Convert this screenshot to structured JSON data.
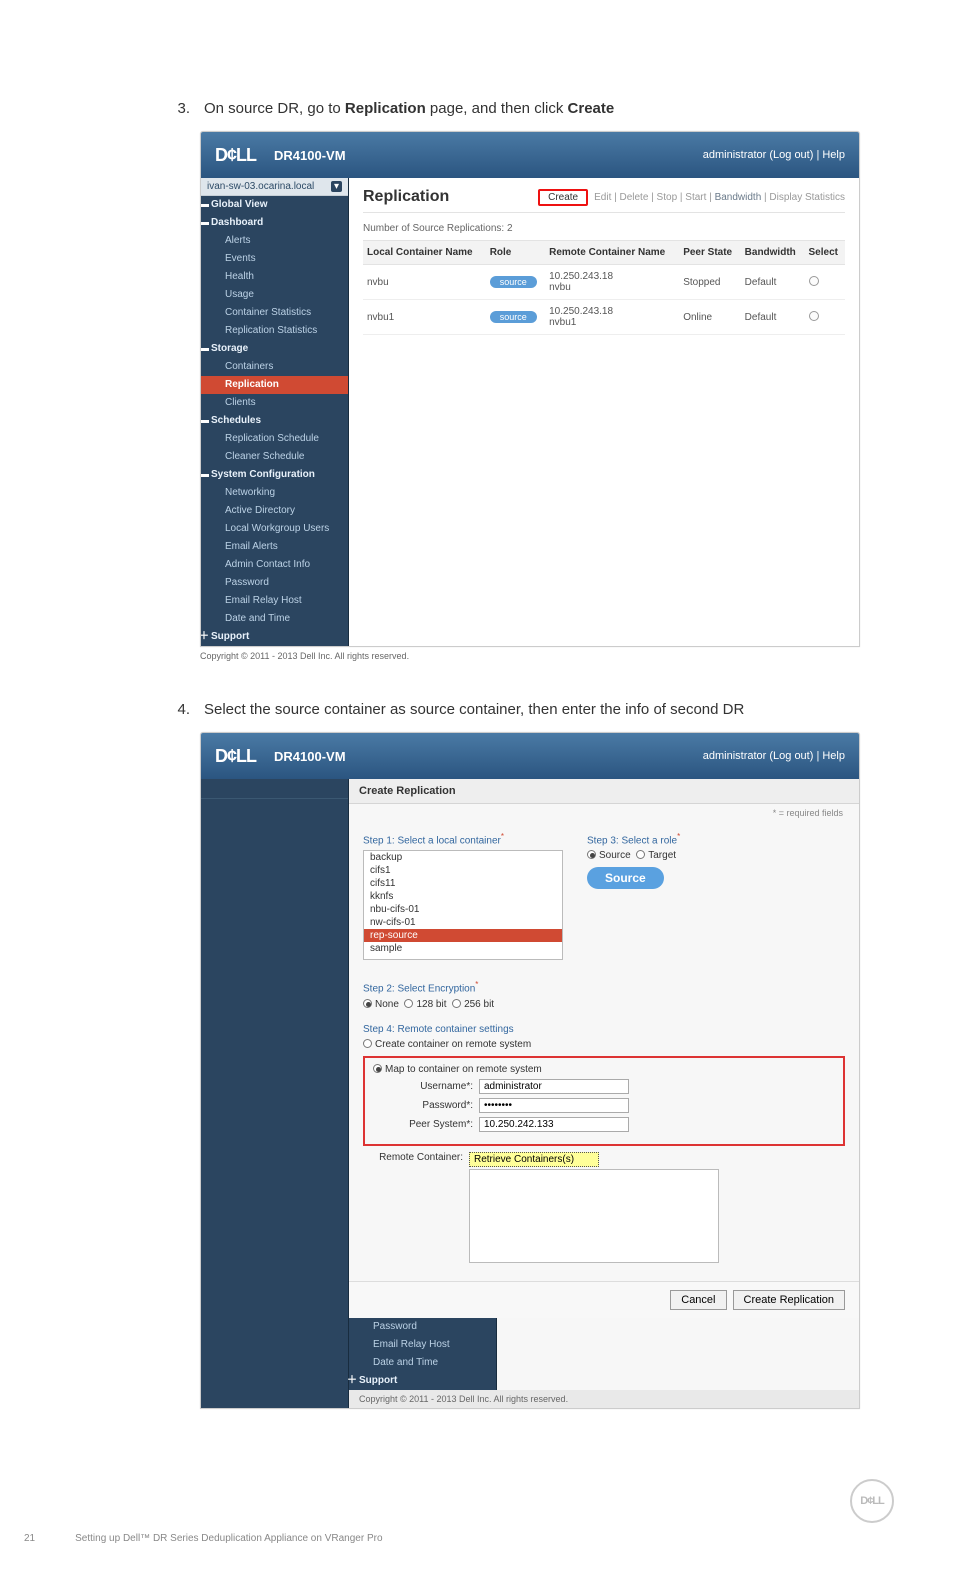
{
  "step3": {
    "num": "3.",
    "pre": "On source DR, go to ",
    "b1": "Replication",
    "mid": " page, and then click ",
    "b2": "Create"
  },
  "step4": {
    "num": "4.",
    "text": "Select the source container as source container, then enter the info of second DR"
  },
  "shell": {
    "brand": "D¢LL",
    "model": "DR4100-VM",
    "user_line": "administrator (Log out) | Help"
  },
  "host": "ivan-sw-03.ocarina.local",
  "nav": {
    "global_view": "Global View",
    "dashboard": "Dashboard",
    "alerts": "Alerts",
    "events": "Events",
    "health": "Health",
    "usage": "Usage",
    "container_stats": "Container Statistics",
    "replication_stats": "Replication Statistics",
    "storage": "Storage",
    "containers": "Containers",
    "replication": "Replication",
    "clients": "Clients",
    "schedules": "Schedules",
    "rep_schedule": "Replication Schedule",
    "cleaner_schedule": "Cleaner Schedule",
    "sys_config": "System Configuration",
    "networking": "Networking",
    "active_directory": "Active Directory",
    "local_workgroup": "Local Workgroup Users",
    "email_alerts": "Email Alerts",
    "admin_contact": "Admin Contact Info",
    "password": "Password",
    "email_relay": "Email Relay Host",
    "date_time": "Date and Time",
    "support": "Support"
  },
  "main1": {
    "title": "Replication",
    "create": "Create",
    "actions_disabled": "Edit | Delete | Stop | Start | ",
    "bw": "Bandwidth",
    "ds": " | Display Statistics",
    "count_line": "Number of Source Replications: 2",
    "cols": {
      "c1": "Local Container Name",
      "c2": "Role",
      "c3": "Remote Container Name",
      "c4": "Peer State",
      "c5": "Bandwidth",
      "c6": "Select"
    },
    "rows": [
      {
        "local": "nvbu",
        "role": "source",
        "remote_ip": "10.250.243.18",
        "remote_name": "nvbu",
        "state": "Stopped",
        "bw": "Default"
      },
      {
        "local": "nvbu1",
        "role": "source",
        "remote_ip": "10.250.243.18",
        "remote_name": "nvbu1",
        "state": "Online",
        "bw": "Default"
      }
    ]
  },
  "main2": {
    "crumb": "Create Replication",
    "required_note": "* = required fields",
    "step1_title": "Step 1: Select a local container",
    "containers": [
      "backup",
      "cifs1",
      "cifs11",
      "kknfs",
      "nbu-cifs-01",
      "nw-cifs-01",
      "rep-source",
      "sample"
    ],
    "selected_container": "rep-source",
    "step2_title": "Step 2: Select Encryption",
    "enc_options": {
      "none": "None",
      "b128": "128 bit",
      "b256": "256 bit"
    },
    "step3_title": "Step 3: Select a role",
    "role_options": {
      "source": "Source",
      "target": "Target"
    },
    "src_badge": "Source",
    "step4_title": "Step 4: Remote container settings",
    "opt_create": "Create container on remote system",
    "opt_map": "Map to container on remote system",
    "labels": {
      "username": "Username*:",
      "password": "Password*:",
      "peer": "Peer System*:",
      "remote_container": "Remote Container:"
    },
    "values": {
      "username": "administrator",
      "password": "••••••••",
      "peer": "10.250.242.133",
      "remote_placeholder": "Retrieve Containers(s)"
    },
    "buttons": {
      "cancel": "Cancel",
      "create": "Create Replication"
    }
  },
  "copyright": "Copyright © 2011 - 2013 Dell Inc. All rights reserved.",
  "footer": {
    "pagenum": "21",
    "title": "Setting up Dell™ DR Series Deduplication Appliance on VRanger Pro",
    "logo": "D¢LL"
  }
}
